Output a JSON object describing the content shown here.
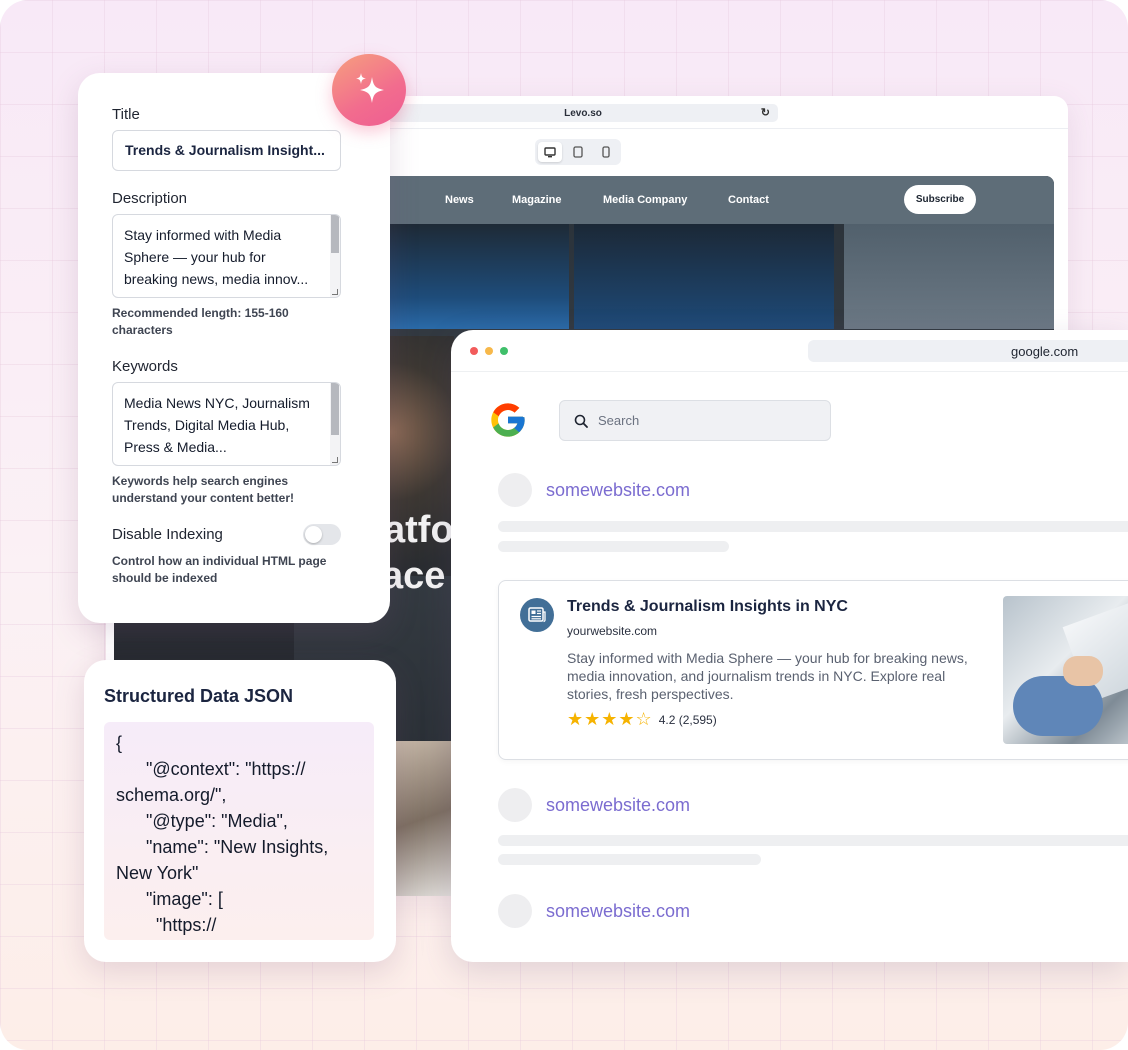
{
  "back_browser": {
    "url": "Levo.so",
    "nav": [
      "News",
      "Magazine",
      "Media Company",
      "Contact"
    ],
    "subscribe_label": "Subscribe",
    "hero_line1": "atfo",
    "hero_line2": "ace"
  },
  "seo_panel": {
    "title_label": "Title",
    "title_value": "Trends & Journalism Insight...",
    "description_label": "Description",
    "description_value": "Stay informed with Media Sphere — your hub for breaking news, media innov...",
    "description_help": "Recommended length: 155-160 characters",
    "keywords_label": "Keywords",
    "keywords_value": "Media News NYC, Journalism Trends, Digital Media Hub, Press & Media...",
    "keywords_help": "Keywords help search engines understand your content better!",
    "indexing_label": "Disable Indexing",
    "indexing_enabled": false,
    "indexing_help": "Control how an individual HTML page should be indexed"
  },
  "json_card": {
    "title": "Structured Data JSON",
    "code": "{\n      \"@context\": \"https://\nschema.org/\",\n      \"@type\": \"Media\",\n      \"name\": \"New Insights,\nNew York\"\n      \"image\": [\n        \"https://"
  },
  "google": {
    "url": "google.com",
    "search_placeholder": "Search",
    "results": [
      "somewebsite.com",
      "somewebsite.com",
      "somewebsite.com"
    ],
    "featured": {
      "title": "Trends & Journalism Insights in NYC",
      "url": "yourwebsite.com",
      "description": "Stay informed with Media Sphere — your hub for breaking news, media innovation, and journalism trends in NYC. Explore real stories, fresh perspectives.",
      "rating": 4,
      "rating_text": "4.2 (2,595)"
    }
  },
  "colors": {
    "accent_purple": "#7b6cd0",
    "sparkle_gradient_start": "#f6a07e",
    "sparkle_gradient_end": "#ee5d92",
    "star": "#f6b300"
  }
}
